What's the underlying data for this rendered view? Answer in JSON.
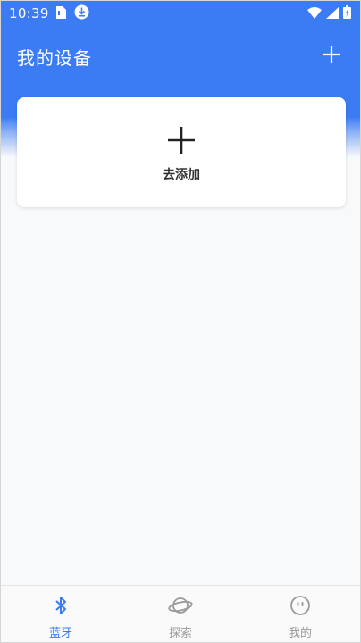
{
  "status_bar": {
    "time": "10:39",
    "icons": [
      "sim-card-icon",
      "download-notification-icon",
      "wifi-icon",
      "signal-icon",
      "battery-charging-icon"
    ]
  },
  "app_bar": {
    "title": "我的设备",
    "add_icon": "plus-icon"
  },
  "add_card": {
    "icon": "plus-icon",
    "label": "去添加"
  },
  "bottom_nav": {
    "items": [
      {
        "label": "蓝牙",
        "icon": "bluetooth-icon",
        "active": true
      },
      {
        "label": "探索",
        "icon": "planet-icon",
        "active": false
      },
      {
        "label": "我的",
        "icon": "face-icon",
        "active": false
      }
    ]
  },
  "colors": {
    "primary": "#3b7cf4",
    "inactive": "#9a9a9a",
    "background": "#f8f9fb"
  }
}
